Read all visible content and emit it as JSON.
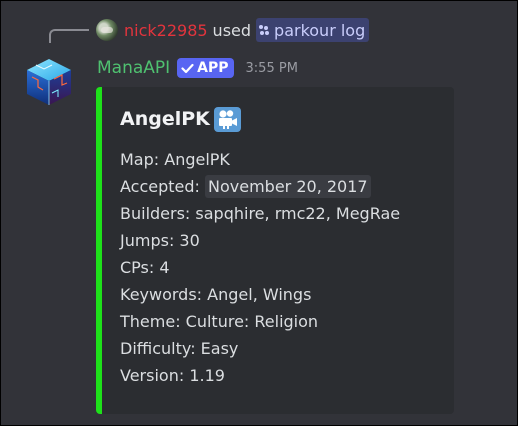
{
  "reply": {
    "username": "nick22985",
    "action": "used",
    "command_name": "parkour log"
  },
  "message": {
    "author": "ManaAPI",
    "badge": "APP",
    "timestamp": "3:55 PM"
  },
  "embed": {
    "accent_color": "#1ee11a",
    "title": "AngelPK",
    "title_icon": "movie-camera-icon",
    "fields": [
      {
        "label": "Map: ",
        "value": "AngelPK"
      },
      {
        "label": "Accepted: ",
        "value": "November 20, 2017"
      },
      {
        "label": "Builders: ",
        "value": "sapqhire, rmc22, MegRae"
      },
      {
        "label": "Jumps: ",
        "value": "30"
      },
      {
        "label": "CPs: ",
        "value": "4"
      },
      {
        "label": "Keywords: ",
        "value": "Angel, Wings"
      },
      {
        "label": "Theme: ",
        "value": "Culture: Religion"
      },
      {
        "label": "Difficulty: ",
        "value": "Easy"
      },
      {
        "label": "Version: ",
        "value": "1.19"
      }
    ]
  },
  "colors": {
    "background": "#323339",
    "username_reply": "#e2343d",
    "author": "#4fc170",
    "badge": "#5865f2",
    "command_chip": "#3c4270"
  }
}
